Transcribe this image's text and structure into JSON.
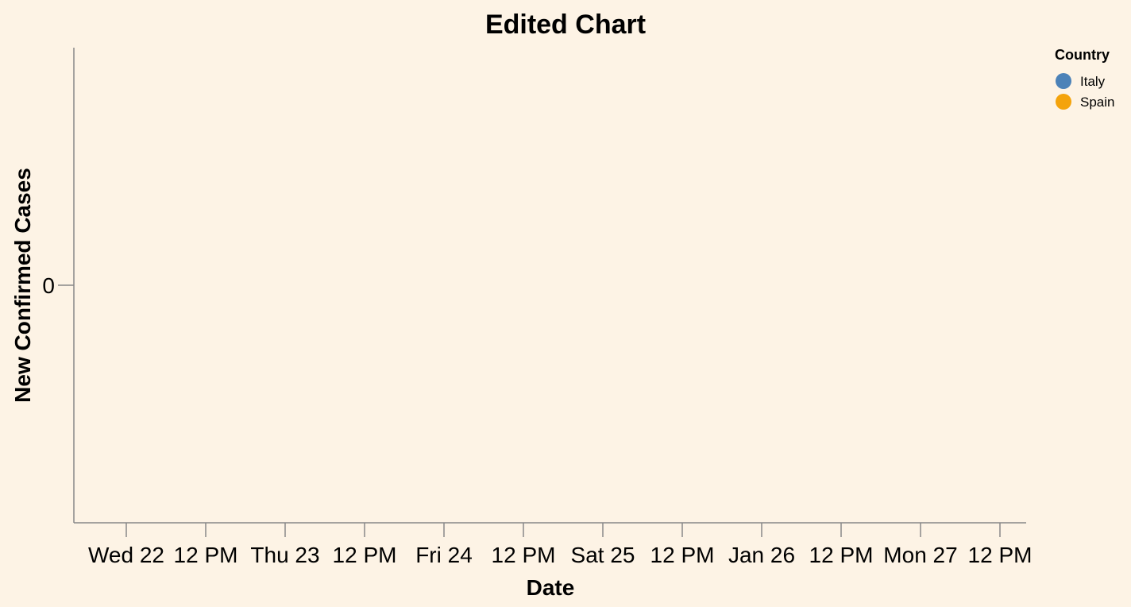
{
  "chart_data": {
    "type": "line",
    "title": "Edited Chart",
    "xlabel": "Date",
    "ylabel": "New Confirmed Cases",
    "x_ticks": [
      "Wed 22",
      "12 PM",
      "Thu 23",
      "12 PM",
      "Fri 24",
      "12 PM",
      "Sat 25",
      "12 PM",
      "Jan 26",
      "12 PM",
      "Mon 27",
      "12 PM"
    ],
    "y_ticks": [
      0
    ],
    "legend": {
      "title": "Country",
      "position": "top-right",
      "entries": [
        {
          "label": "Italy",
          "color": "#4c82b8"
        },
        {
          "label": "Spain",
          "color": "#f4a30b"
        }
      ]
    },
    "series": [
      {
        "name": "Italy",
        "color": "#4c82b8",
        "values": []
      },
      {
        "name": "Spain",
        "color": "#f4a30b",
        "values": []
      }
    ],
    "grid": false
  }
}
